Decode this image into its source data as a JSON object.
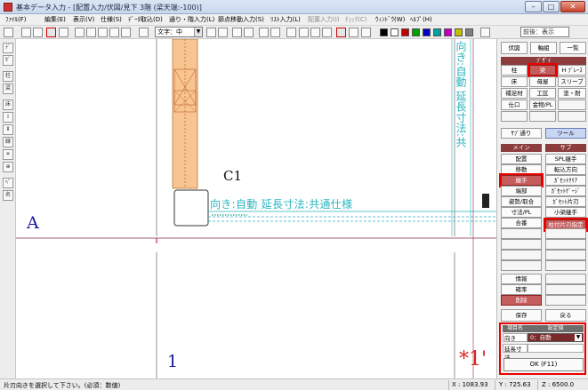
{
  "window": {
    "title": "基本データ入力 - [配置入力/伏図/見下 3階 (梁天端:-100)]",
    "buttons": [
      "–",
      "□",
      "✕"
    ]
  },
  "menubar": {
    "items": [
      {
        "label": "ﾌｧｲﾙ(F)",
        "disabled": false
      },
      {
        "label": "編集(E)",
        "disabled": false
      },
      {
        "label": "表示(V)",
        "disabled": false
      },
      {
        "label": "仕様(S)",
        "disabled": false
      },
      {
        "label": "ﾃﾞｰﾀ取込(D)",
        "disabled": false
      },
      {
        "label": "通り・階入力(L)",
        "disabled": false
      },
      {
        "label": "節点移動入力(S)",
        "disabled": false
      },
      {
        "label": "ﾘｽﾄ入力(L)",
        "disabled": false
      },
      {
        "label": "配置入力(I)",
        "disabled": true
      },
      {
        "label": "ﾁｪｯｸ(C)",
        "disabled": true
      },
      {
        "label": "ｳｨﾝﾄﾞｳ(W)",
        "disabled": false
      },
      {
        "label": "ﾍﾙﾌﾟ(H)",
        "disabled": false
      }
    ]
  },
  "toolbar": {
    "font_select": "文字：中",
    "right_select": "前後：表示",
    "colors": [
      "#000000",
      "#ffffff",
      "#c00000",
      "#00a000",
      "#0000c0",
      "#00a0a0",
      "#c000c0",
      "#c0c000",
      "#808080"
    ]
  },
  "lefttoolbar": {
    "items": [
      "ﾃﾞ",
      "ｾﾞ",
      "柱",
      "梁",
      "床",
      "Ⅰ",
      "Ⅱ",
      "線",
      "✕",
      "⊕",
      "ﾍﾟ",
      "名"
    ]
  },
  "canvas": {
    "column_label": "C1",
    "annotation": "向き:自動  延長寸法:共通仕様",
    "vertical_annotation": "向き:自動  延長寸法:共",
    "axis_left": "A",
    "axis_bottom": "1",
    "axis_right": "*1'"
  },
  "panel": {
    "top_tabs": [
      "伏図",
      "軸組",
      "一覧"
    ],
    "buzai_header": "ﾌﾞｻﾞｲ",
    "buzai_items": [
      "柱",
      "梁",
      "H ﾌﾞﾚｰｽ",
      "床",
      "母屋",
      "スリーブ",
      "補足材",
      "工区",
      "塗・耐",
      "仕口",
      "金物/PL"
    ],
    "buzai_extra": [
      "ｻﾌﾞ通り",
      "ツール"
    ],
    "main_header": "メイン",
    "sub_header": "サブ",
    "main_items": [
      "配置",
      "移動",
      "継手",
      "端部",
      "姿勢/取合",
      "寸法/PL",
      "合番"
    ],
    "sub_items": [
      "SPL継手",
      "転込方向",
      "ｶﾞｾｯﾄｸﾘｱ",
      "ｶﾞｾｯﾄｹﾞｰｼﾞ",
      "ｶﾞｾｯﾄ片刃",
      "小梁継手",
      "柱付片刃指定"
    ],
    "bottom_items": [
      "情報",
      "確率",
      "削除"
    ],
    "save_label": "保存",
    "back_label": "戻る",
    "props": {
      "col_name": "項目名",
      "col_value": "設定値",
      "row1_label": "向き",
      "row1_value": "0：自動",
      "row2_label": "延長寸法",
      "row2_value": "",
      "ok_label": "OK (F11)"
    }
  },
  "status": {
    "message": "片刃向きを選択して下さい。(必須：数値)",
    "x": "X : 1083.93",
    "y": "Y : 725.63",
    "z": "Z : 6500.0"
  }
}
